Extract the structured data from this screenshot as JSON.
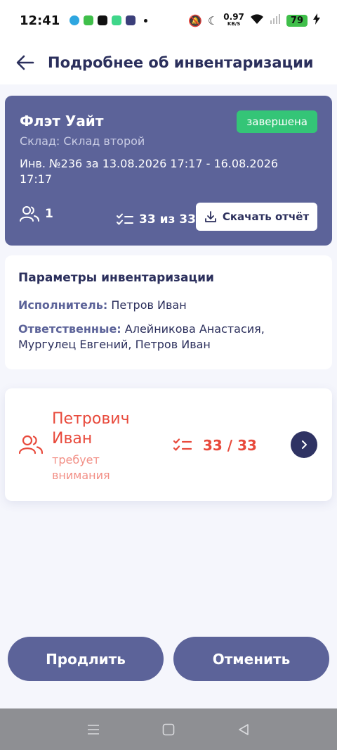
{
  "status_bar": {
    "time": "12:41",
    "speed_value": "0.97",
    "speed_unit": "KB/S",
    "battery": "79"
  },
  "header": {
    "title": "Подробнее об инвентаризации"
  },
  "summary": {
    "name": "Флэт Уайт",
    "warehouse": "Склад: Склад второй",
    "period": "Инв. №236 за 13.08.2026 17:17 - 16.08.2026 17:17",
    "status": "завершена",
    "users_count": "1",
    "items_progress": "33 из 33",
    "download_label": "Скачать отчёт"
  },
  "params": {
    "title": "Параметры инвентаризации",
    "executor_label": "Исполнитель:",
    "executor_value": "Петров Иван",
    "responsible_label": "Ответственные:",
    "responsible_value": "Алейникова Анастасия, Мургулец Евгений, Петров Иван"
  },
  "executor_card": {
    "name": "Петрович Иван",
    "status": "требует внимания",
    "progress": "33 / 33"
  },
  "actions": {
    "extend_label": "Продлить",
    "cancel_label": "Отменить"
  },
  "colors": {
    "primary": "#5c6399",
    "dark": "#2b2f5c",
    "success": "#34c577",
    "danger": "#e84a3c",
    "background": "#f5f6fc"
  }
}
